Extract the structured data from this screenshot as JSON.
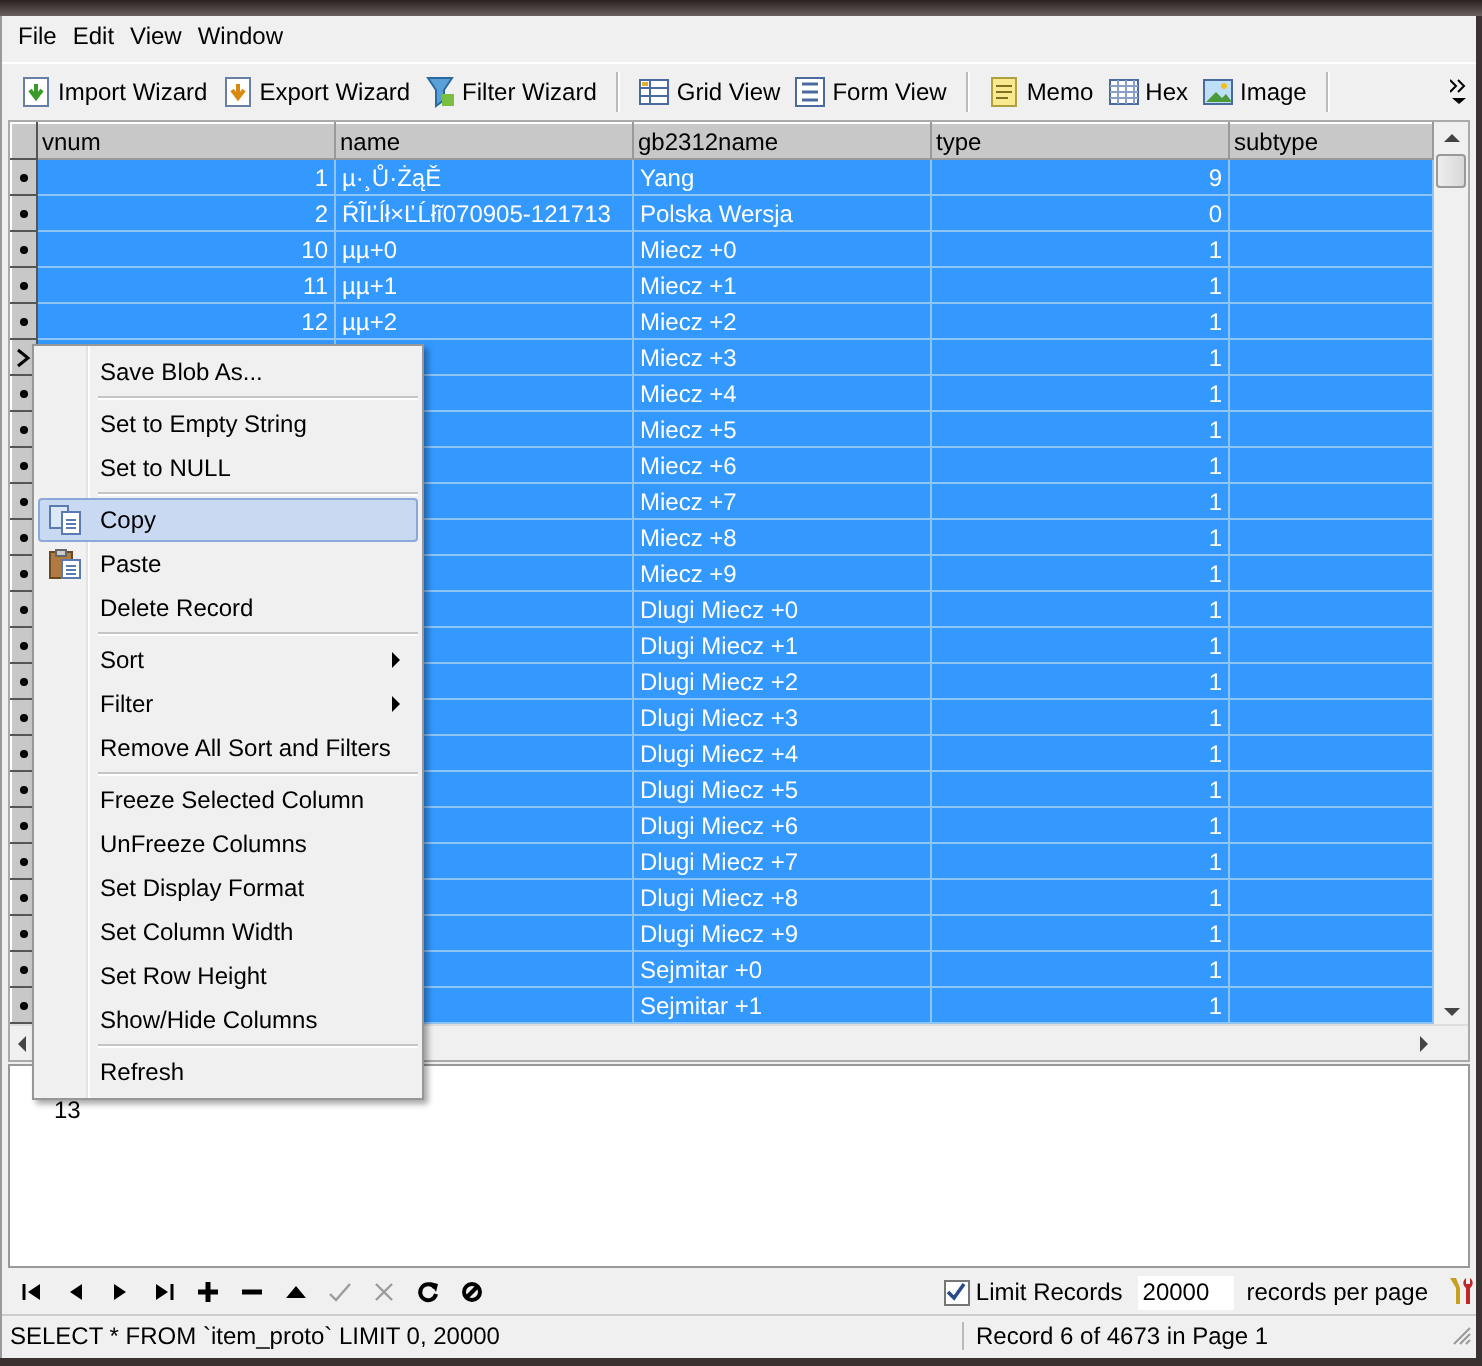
{
  "menu_bar": [
    "File",
    "Edit",
    "View",
    "Window"
  ],
  "toolbar": [
    {
      "kind": "import",
      "label": "Import Wizard"
    },
    {
      "kind": "export",
      "label": "Export Wizard"
    },
    {
      "kind": "filter",
      "label": "Filter Wizard"
    },
    {
      "kind": "separator"
    },
    {
      "kind": "grid",
      "label": "Grid View"
    },
    {
      "kind": "form",
      "label": "Form View"
    },
    {
      "kind": "separator"
    },
    {
      "kind": "memo",
      "label": "Memo"
    },
    {
      "kind": "hex",
      "label": "Hex"
    },
    {
      "kind": "image",
      "label": "Image"
    },
    {
      "kind": "separator"
    }
  ],
  "table": {
    "columns": [
      "vnum",
      "name",
      "gb2312name",
      "type",
      "subtype"
    ],
    "rows": [
      {
        "current": false,
        "selected": true,
        "vnum": "1",
        "name": "µ·¸Ů·ŻąĚ",
        "gb2312name": "Yang",
        "type": "9"
      },
      {
        "current": false,
        "selected": true,
        "vnum": "2",
        "name": "ŔĨĽĺł×ĽĹłĩ070905-121713",
        "gb2312name": "Polska Wersja",
        "type": "0"
      },
      {
        "current": false,
        "selected": true,
        "vnum": "10",
        "name": "µµ+0",
        "gb2312name": "Miecz +0",
        "type": "1"
      },
      {
        "current": false,
        "selected": true,
        "vnum": "11",
        "name": "µµ+1",
        "gb2312name": "Miecz +1",
        "type": "1"
      },
      {
        "current": false,
        "selected": true,
        "vnum": "12",
        "name": "µµ+2",
        "gb2312name": "Miecz +2",
        "type": "1"
      },
      {
        "current": true,
        "selected": true,
        "gb2312name": "Miecz +3",
        "type": "1"
      },
      {
        "current": false,
        "selected": true,
        "gb2312name": "Miecz +4",
        "type": "1"
      },
      {
        "current": false,
        "selected": true,
        "gb2312name": "Miecz +5",
        "type": "1"
      },
      {
        "current": false,
        "selected": true,
        "gb2312name": "Miecz +6",
        "type": "1"
      },
      {
        "current": false,
        "selected": true,
        "gb2312name": "Miecz +7",
        "type": "1"
      },
      {
        "current": false,
        "selected": true,
        "gb2312name": "Miecz +8",
        "type": "1"
      },
      {
        "current": false,
        "selected": true,
        "gb2312name": "Miecz +9",
        "type": "1"
      },
      {
        "current": false,
        "selected": true,
        "gb2312name": "Dlugi Miecz +0",
        "type": "1"
      },
      {
        "current": false,
        "selected": true,
        "gb2312name": "Dlugi Miecz +1",
        "type": "1"
      },
      {
        "current": false,
        "selected": true,
        "gb2312name": "Dlugi Miecz +2",
        "type": "1"
      },
      {
        "current": false,
        "selected": true,
        "gb2312name": "Dlugi Miecz +3",
        "type": "1"
      },
      {
        "current": false,
        "selected": true,
        "gb2312name": "Dlugi Miecz +4",
        "type": "1"
      },
      {
        "current": false,
        "selected": true,
        "gb2312name": "Dlugi Miecz +5",
        "type": "1"
      },
      {
        "current": false,
        "selected": true,
        "gb2312name": "Dlugi Miecz +6",
        "type": "1"
      },
      {
        "current": false,
        "selected": true,
        "gb2312name": "Dlugi Miecz +7",
        "type": "1"
      },
      {
        "current": false,
        "selected": true,
        "gb2312name": "Dlugi Miecz +8",
        "type": "1"
      },
      {
        "current": false,
        "selected": true,
        "gb2312name": "Dlugi Miecz +9",
        "type": "1"
      },
      {
        "current": false,
        "selected": true,
        "gb2312name": "Sejmitar +0",
        "type": "1"
      },
      {
        "current": false,
        "selected": true,
        "gb2312name": "Sejmitar +1",
        "type": "1"
      }
    ]
  },
  "context_menu": [
    {
      "kind": "item",
      "label": "Save Blob As...",
      "selected": false
    },
    {
      "kind": "separator"
    },
    {
      "kind": "item",
      "label": "Set to Empty String",
      "selected": false
    },
    {
      "kind": "item",
      "label": "Set to NULL",
      "selected": false
    },
    {
      "kind": "separator"
    },
    {
      "kind": "copy",
      "label": "Copy",
      "selected": true
    },
    {
      "kind": "paste",
      "label": "Paste",
      "selected": false
    },
    {
      "kind": "item",
      "label": "Delete Record",
      "selected": false
    },
    {
      "kind": "separator"
    },
    {
      "kind": "submenu",
      "label": "Sort",
      "selected": false
    },
    {
      "kind": "submenu",
      "label": "Filter",
      "selected": false
    },
    {
      "kind": "item",
      "label": "Remove All Sort and Filters",
      "selected": false
    },
    {
      "kind": "separator"
    },
    {
      "kind": "item",
      "label": "Freeze Selected Column",
      "selected": false
    },
    {
      "kind": "item",
      "label": "UnFreeze Columns",
      "selected": false
    },
    {
      "kind": "item",
      "label": "Set Display Format",
      "selected": false
    },
    {
      "kind": "item",
      "label": "Set Column Width",
      "selected": false
    },
    {
      "kind": "item",
      "label": "Set Row Height",
      "selected": false
    },
    {
      "kind": "item",
      "label": "Show/Hide Columns",
      "selected": false
    },
    {
      "kind": "separator"
    },
    {
      "kind": "item",
      "label": "Refresh",
      "selected": false
    }
  ],
  "memo": {
    "value": "13"
  },
  "navigator": [
    {
      "kind": "first",
      "disabled": false
    },
    {
      "kind": "prev",
      "disabled": false
    },
    {
      "kind": "next",
      "disabled": false
    },
    {
      "kind": "last",
      "disabled": false
    },
    {
      "kind": "add",
      "disabled": false
    },
    {
      "kind": "delete",
      "disabled": false
    },
    {
      "kind": "edit",
      "disabled": false
    },
    {
      "kind": "post",
      "disabled": true
    },
    {
      "kind": "cancel",
      "disabled": true
    },
    {
      "kind": "refresh",
      "disabled": false
    },
    {
      "kind": "stop",
      "disabled": false
    }
  ],
  "limit": {
    "label": "Limit Records",
    "checked": true,
    "value": "20000",
    "suffix": "records per page"
  },
  "status_bar": {
    "query": "SELECT * FROM `item_proto` LIMIT 0, 20000",
    "record": "Record 6 of 4673 in Page 1"
  }
}
